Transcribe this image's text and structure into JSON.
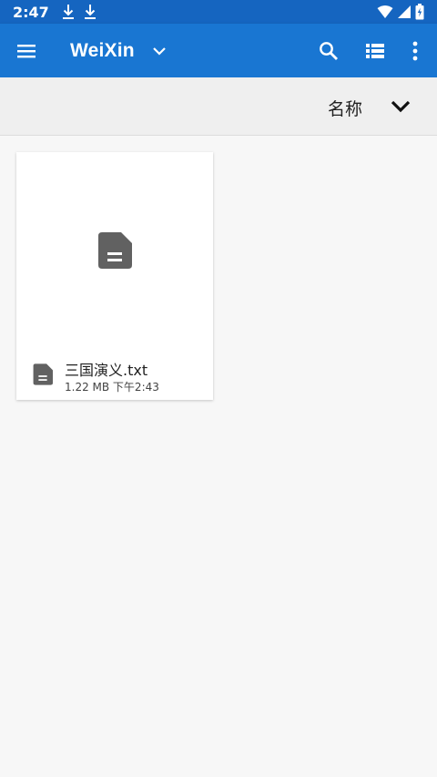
{
  "status_bar": {
    "time": "2:47"
  },
  "app_bar": {
    "title": "WeiXin",
    "icons": [
      "menu-icon",
      "chevron-down-icon",
      "search-icon",
      "list-view-icon",
      "more-vert-icon"
    ]
  },
  "sort": {
    "label": "名称"
  },
  "files": [
    {
      "name": "三国演义.txt",
      "size": "1.22 MB",
      "time": "下午2:43",
      "meta": "1.22 MB 下午2:43",
      "icon": "document-icon"
    }
  ],
  "colors": {
    "status_bar": "#1565c0",
    "app_bar": "#1976d2",
    "background": "#f7f7f7",
    "icon_grey": "#616161"
  }
}
